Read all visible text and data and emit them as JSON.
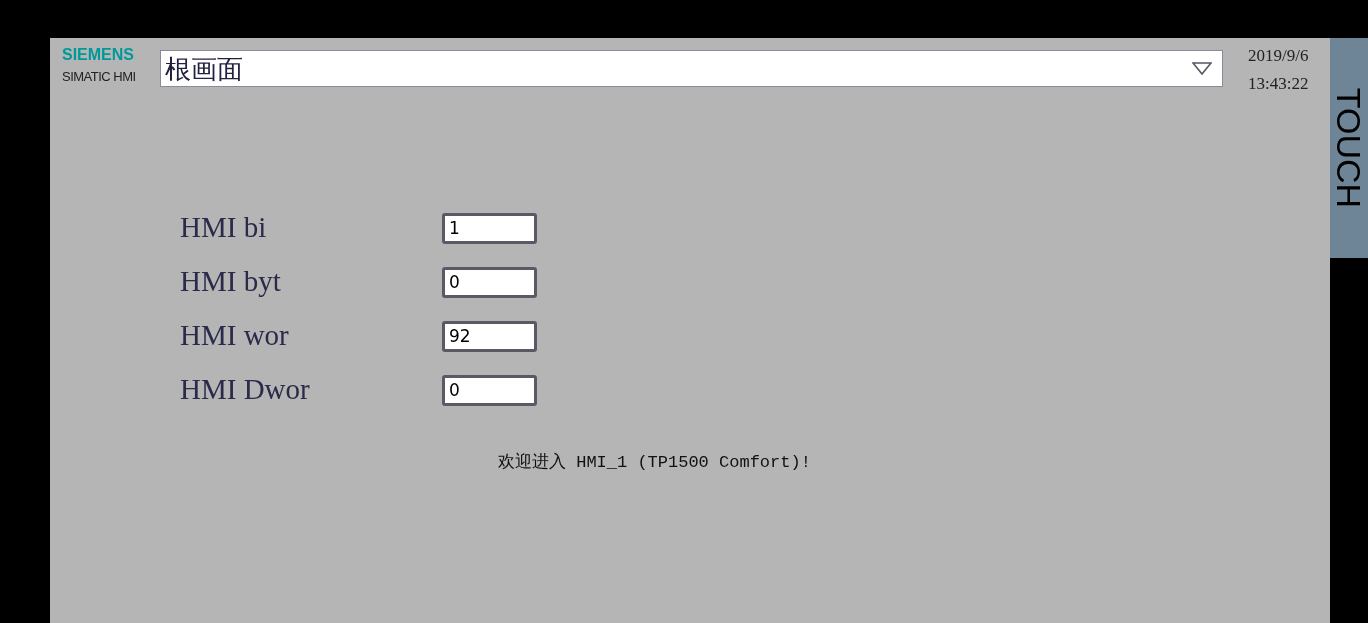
{
  "header": {
    "brand": "SIEMENS",
    "product": "SIMATIC HMI",
    "screen_selector": {
      "value": "根画面"
    },
    "date": "2019/9/6",
    "time": "13:43:22"
  },
  "side_label": "TOUCH",
  "fields": [
    {
      "label": "HMI bi",
      "value": "1"
    },
    {
      "label": "HMI byt",
      "value": "0"
    },
    {
      "label": "HMI wor",
      "value": "92"
    },
    {
      "label": "HMI Dwor",
      "value": "0"
    }
  ],
  "welcome": "欢迎进入 HMI_1 (TP1500 Comfort)!"
}
